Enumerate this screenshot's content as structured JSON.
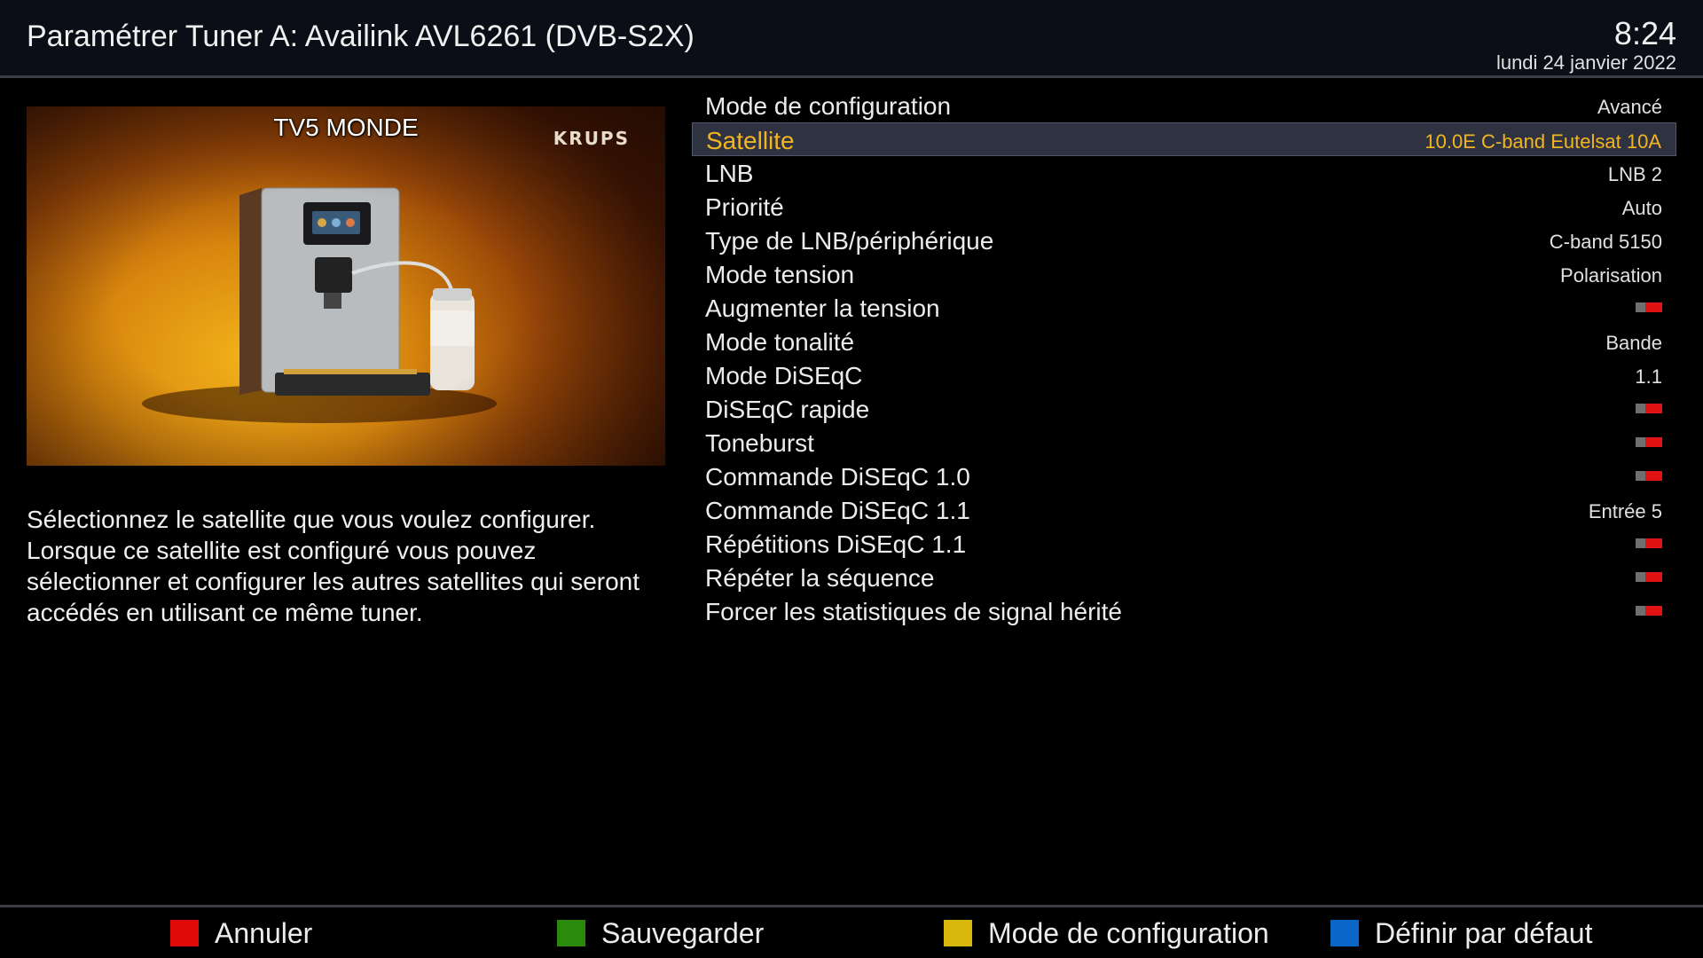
{
  "header": {
    "title": "Paramétrer Tuner A: Availink AVL6261 (DVB-S2X)",
    "time": "8:24",
    "date": "lundi 24 janvier 2022"
  },
  "preview": {
    "channel": "TV5 MONDE",
    "brand": "KRUPS"
  },
  "help_text": "Sélectionnez le satellite que vous voulez configurer. Lorsque ce satellite est configuré vous pouvez sélectionner et configurer les autres satellites qui seront accédés en utilisant ce même tuner.",
  "settings": [
    {
      "label": "Mode de configuration",
      "value": "Avancé"
    },
    {
      "label": "Satellite",
      "value": "10.0E C-band Eutelsat 10A"
    },
    {
      "label": "LNB",
      "value": "LNB 2"
    },
    {
      "label": "Priorité",
      "value": "Auto"
    },
    {
      "label": "Type de LNB/périphérique",
      "value": "C-band 5150"
    },
    {
      "label": "Mode tension",
      "value": "Polarisation"
    },
    {
      "label": "Augmenter la tension",
      "value": ""
    },
    {
      "label": "Mode tonalité",
      "value": "Bande"
    },
    {
      "label": "Mode DiSEqC",
      "value": "1.1"
    },
    {
      "label": "DiSEqC rapide",
      "value": ""
    },
    {
      "label": "Toneburst",
      "value": ""
    },
    {
      "label": "Commande DiSEqC 1.0",
      "value": ""
    },
    {
      "label": "Commande DiSEqC 1.1",
      "value": "Entrée 5"
    },
    {
      "label": "Répétitions DiSEqC 1.1",
      "value": ""
    },
    {
      "label": "Répéter la séquence",
      "value": ""
    },
    {
      "label": "Forcer les statistiques de signal hérité",
      "value": ""
    }
  ],
  "selected_index": 1,
  "toggle_state": "off",
  "footer": {
    "red": "Annuler",
    "green": "Sauvegarder",
    "yellow": "Mode de configuration",
    "blue": "Définir par défaut"
  },
  "colors": {
    "selected_text": "#f2b522",
    "red_key": "#e00a0a",
    "green_key": "#2a8a0c",
    "yellow_key": "#d9b80e",
    "blue_key": "#0a66c8"
  }
}
